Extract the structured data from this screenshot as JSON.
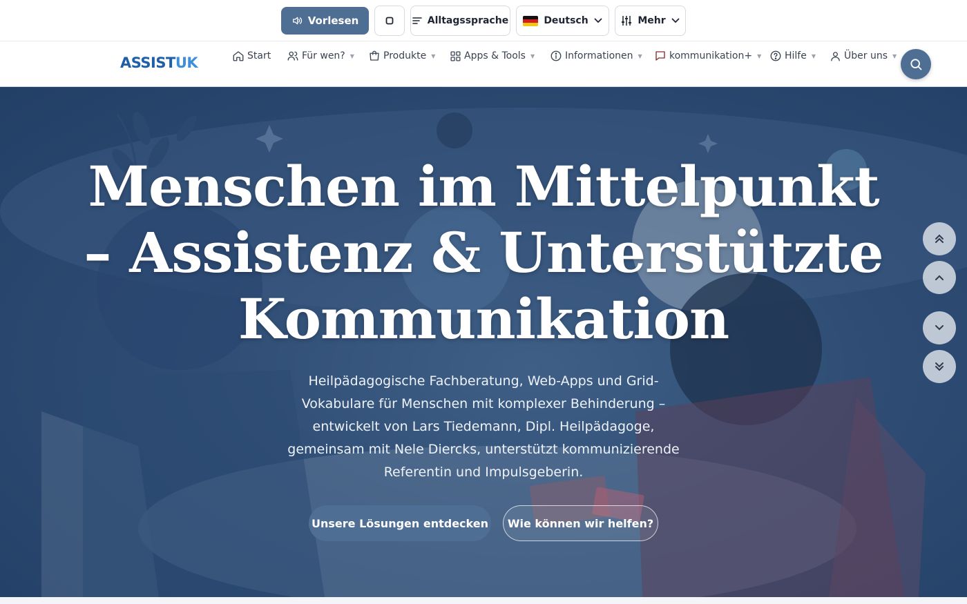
{
  "toolbar": {
    "read_aloud": "Vorlesen",
    "plain_language": "Alltagssprache",
    "language": "Deutsch",
    "more": "Mehr"
  },
  "brand": {
    "logo_part1": "ASSIST",
    "logo_part2": "UK"
  },
  "nav": {
    "items": [
      {
        "label": "Start",
        "icon": "home-icon"
      },
      {
        "label": "Für wen?",
        "icon": "users-icon"
      },
      {
        "label": "Produkte",
        "icon": "bag-icon"
      },
      {
        "label": "Apps & Tools",
        "icon": "grid-icon"
      },
      {
        "label": "Informationen",
        "icon": "info-icon"
      },
      {
        "label": "kommunikation+",
        "icon": "chat-icon"
      },
      {
        "label": "Hilfe",
        "icon": "help-icon"
      },
      {
        "label": "Über uns",
        "icon": "user-icon"
      }
    ]
  },
  "hero": {
    "title_line1": "Menschen im Mittelpunkt",
    "title_line2": "– Assistenz & Unterstützte",
    "title_line3": "Kommunikation",
    "subtitle": "Heilpädagogische Fachberatung, Web-Apps und Grid-Vokabulare für Menschen mit komplexer Behinderung – entwickelt von Lars Tiedemann, Dipl. Heilpädagoge, gemeinsam mit Nele Diercks, unterstützt kommunizierende Referentin und Impulsgeberin.",
    "cta_primary": "Unsere Lösungen entdecken",
    "cta_secondary": "Wie können wir helfen?"
  },
  "colors": {
    "accent": "#4f6e93",
    "hero_dark": "#223f66",
    "logo_blue": "#1f5ea8",
    "logo_light": "#3f8fd8"
  }
}
